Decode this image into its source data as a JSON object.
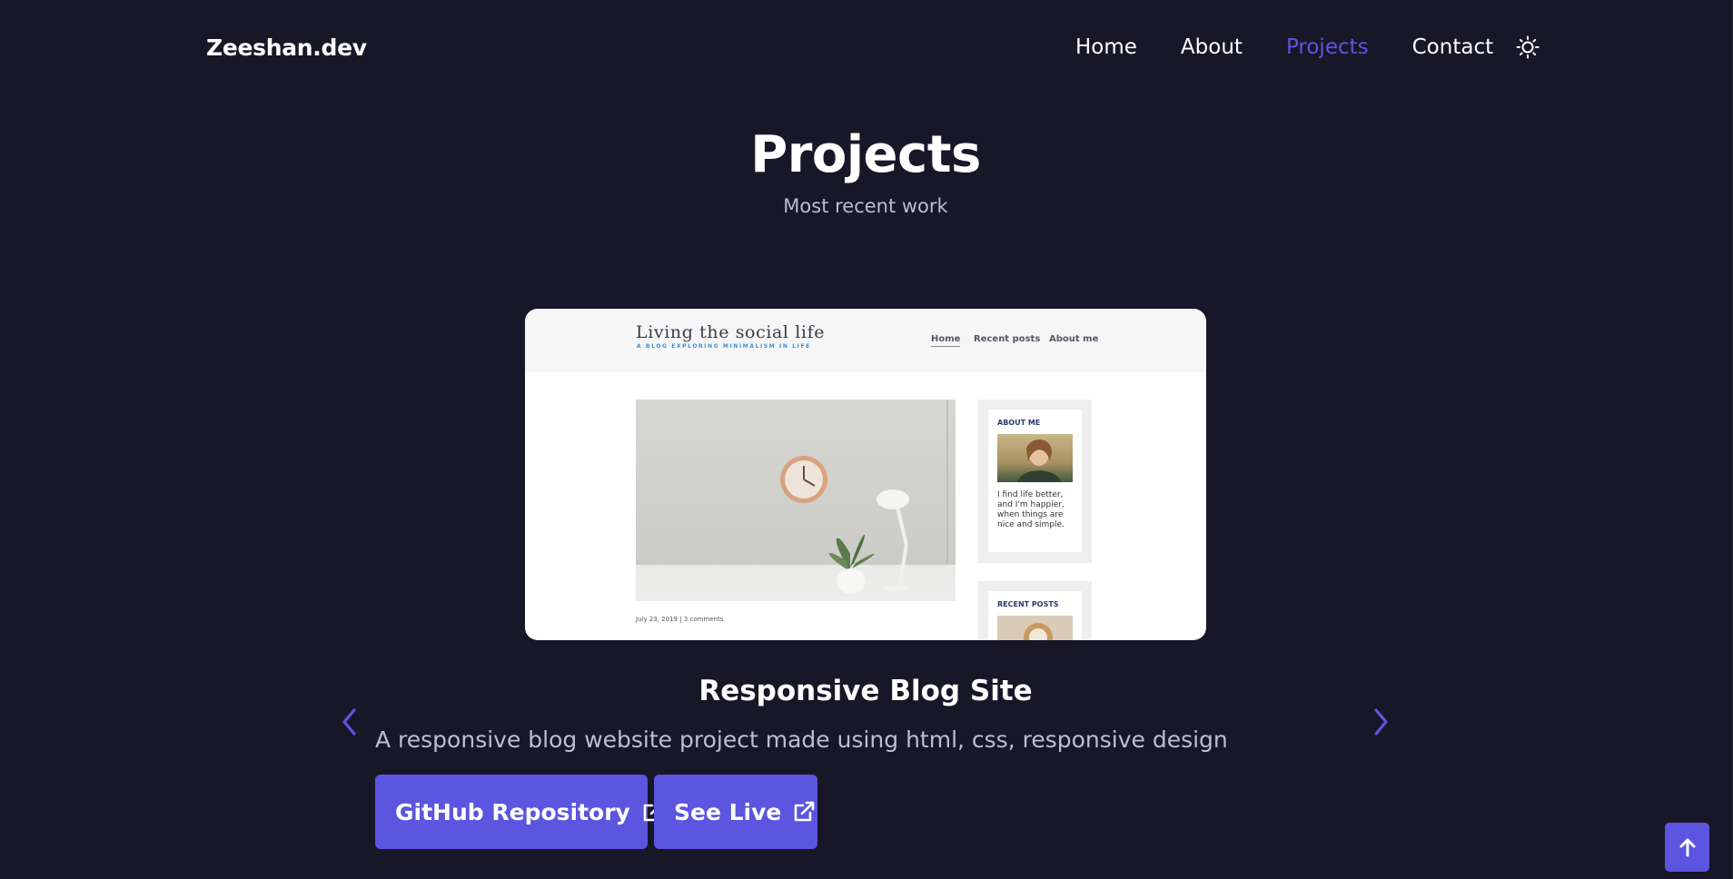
{
  "header": {
    "brand": "Zeeshan.dev",
    "nav": [
      {
        "label": "Home",
        "active": false
      },
      {
        "label": "About",
        "active": false
      },
      {
        "label": "Projects",
        "active": true
      },
      {
        "label": "Contact",
        "active": false
      }
    ],
    "theme_icon": "sun-icon"
  },
  "section": {
    "title": "Projects",
    "subtitle": "Most recent work"
  },
  "project": {
    "name": "Responsive Blog Site",
    "description": "A responsive blog website project made using html, css, responsive design",
    "buttons": {
      "github_label": "GitHub Repository",
      "live_label": "See Live"
    },
    "preview": {
      "site_title": "Living the social life",
      "tagline": "A BLOG EXPLORING MINIMALISM IN LIFE",
      "nav": [
        "Home",
        "Recent posts",
        "About me"
      ],
      "post_meta": "July 23, 2019 | 3 comments",
      "sidebar": {
        "about_heading": "ABOUT ME",
        "about_text": "I find life better, and I'm happier, when things are nice and simple.",
        "recent_heading": "RECENT POSTS"
      }
    }
  },
  "controls": {
    "prev_icon": "chevron-left-icon",
    "next_icon": "chevron-right-icon",
    "scroll_top_icon": "arrow-up-icon"
  },
  "colors": {
    "background": "#181728",
    "accent": "#5b55df",
    "text": "#ffffff",
    "muted_text": "#bcbcd4"
  }
}
